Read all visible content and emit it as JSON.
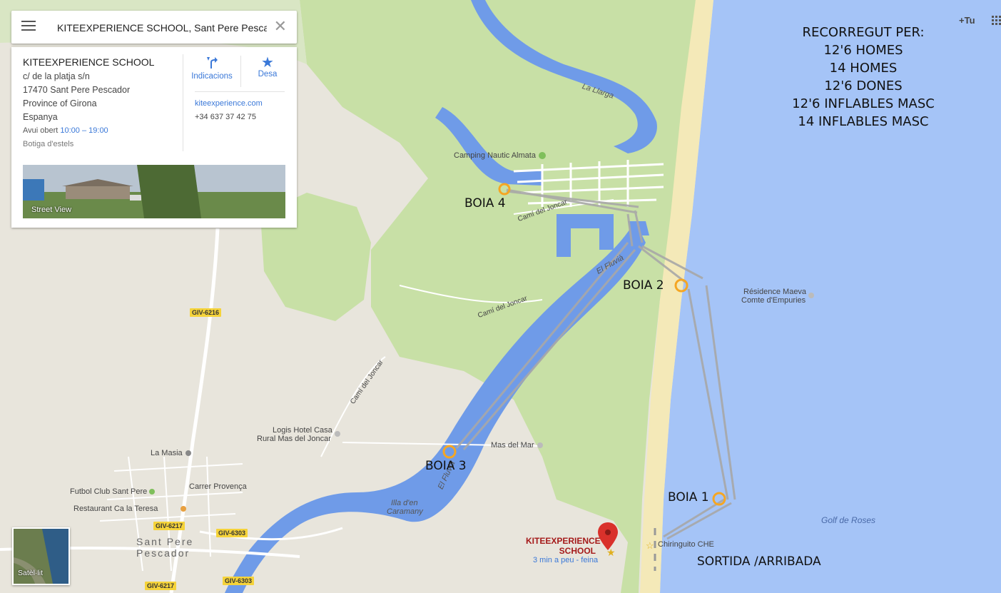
{
  "search": {
    "value": "KITEEXPERIENCE SCHOOL, Sant Pere Pesca"
  },
  "place": {
    "name": "KITEEXPERIENCE SCHOOL",
    "address": [
      "c/ de la platja s/n",
      "17470 Sant Pere Pescador",
      "Province of Girona",
      "Espanya"
    ],
    "hours_prefix": "Avui obert",
    "hours_time": "10:00 – 19:00",
    "category": "Botiga d'estels",
    "actions": {
      "directions": "Indicacions",
      "save": "Desa"
    },
    "website": "kiteexperience.com",
    "phone": "+34 637 37 42 75",
    "streetview_label": "Street View"
  },
  "topbar": {
    "plus_tu": "+Tu"
  },
  "satellite_label": "Satèl·lit",
  "legend": [
    "RECORREGUT PER:",
    "12'6 HOMES",
    "14 HOMES",
    "12'6 DONES",
    "12'6 INFLABLES MASC",
    "14 INFLABLES MASC"
  ],
  "buoys": {
    "boia4": "BOIA 4",
    "boia2": "BOIA 2",
    "boia3": "BOIA 3",
    "boia1": "BOIA 1",
    "start": "SORTIDA /ARRIBADA"
  },
  "map_labels": {
    "la_llarga": "La Llarga",
    "camping": "Camping Nautic Almata",
    "cami_joncar1": "Camí del Joncar",
    "cami_joncar2": "Camí del Joncar",
    "cami_joncar3": "Camí del Joncar",
    "el_fluvia_n": "El Fluvià",
    "el_fluvia_s": "El Fluvià",
    "residence": "Résidence Maeva",
    "residence2": "Comte d'Empuries",
    "logis1": "Logis Hotel Casa",
    "logis2": "Rural Mas del Joncar",
    "mas_del_mar": "Mas del Mar",
    "la_masia": "La Masia",
    "carrer": "Carrer Provença",
    "futbol": "Futbol Club Sant Pere",
    "restaurant": "Restaurant Ca la Teresa",
    "illa1": "Illa d'en",
    "illa2": "Caramany",
    "sant_pere1": "Sant Pere",
    "sant_pere2": "Pescador",
    "golf": "Golf de Roses",
    "chiringuito": "Chiringuito CHE",
    "school1": "KITEEXPERIENCE",
    "school2": "SCHOOL",
    "walk": "3 min a peu - feina"
  },
  "roads": {
    "giv6216": "GIV-6216",
    "giv6217a": "GIV-6217",
    "giv6303a": "GIV-6303",
    "giv6217b": "GIV-6217",
    "giv6303b": "GIV-6303"
  },
  "colors": {
    "sea": "#a5c4f7",
    "river": "#6f9be8",
    "land": "#e8e5dc",
    "green": "#c8e0a6",
    "beach": "#f4e9b8",
    "buoy": "#f5a623",
    "pin": "#d9312b"
  }
}
